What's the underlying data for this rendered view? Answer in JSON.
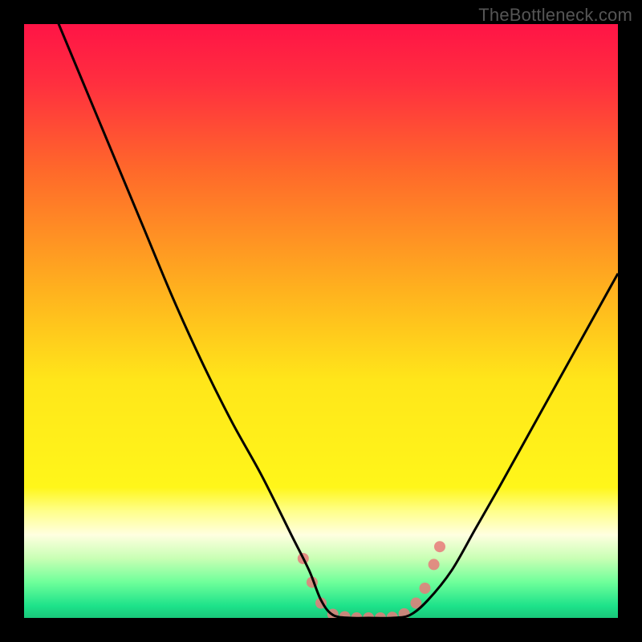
{
  "watermark": "TheBottleneck.com",
  "chart_data": {
    "type": "line",
    "title": "",
    "xlabel": "",
    "ylabel": "",
    "xlim": [
      0,
      100
    ],
    "ylim": [
      0,
      100
    ],
    "background_gradient": [
      {
        "stop": 0.0,
        "color": "#ff1446"
      },
      {
        "stop": 0.1,
        "color": "#ff2f3f"
      },
      {
        "stop": 0.25,
        "color": "#ff6a2a"
      },
      {
        "stop": 0.45,
        "color": "#ffb21e"
      },
      {
        "stop": 0.6,
        "color": "#ffe61a"
      },
      {
        "stop": 0.78,
        "color": "#fff61a"
      },
      {
        "stop": 0.82,
        "color": "#ffff8a"
      },
      {
        "stop": 0.86,
        "color": "#ffffe0"
      },
      {
        "stop": 0.9,
        "color": "#c8ffb4"
      },
      {
        "stop": 0.94,
        "color": "#6eff9a"
      },
      {
        "stop": 0.98,
        "color": "#1de28a"
      },
      {
        "stop": 1.0,
        "color": "#19c87a"
      }
    ],
    "series": [
      {
        "name": "bottleneck-curve",
        "color": "#000000",
        "x": [
          5,
          10,
          15,
          20,
          25,
          30,
          35,
          40,
          45,
          48,
          50,
          52,
          55,
          58,
          62,
          65,
          68,
          72,
          76,
          80,
          85,
          90,
          95,
          100
        ],
        "y": [
          102,
          90,
          78,
          66,
          54,
          43,
          33,
          24,
          14,
          8,
          3,
          0.5,
          0,
          0,
          0,
          0.5,
          3,
          8,
          15,
          22,
          31,
          40,
          49,
          58
        ]
      }
    ],
    "markers": {
      "name": "highlight-dots",
      "color": "#e77a7a",
      "radius": 7,
      "points": [
        {
          "x": 47,
          "y": 10
        },
        {
          "x": 48.5,
          "y": 6
        },
        {
          "x": 50,
          "y": 2.5
        },
        {
          "x": 52,
          "y": 0.6
        },
        {
          "x": 54,
          "y": 0.2
        },
        {
          "x": 56,
          "y": 0.0
        },
        {
          "x": 58,
          "y": 0.0
        },
        {
          "x": 60,
          "y": 0.0
        },
        {
          "x": 62,
          "y": 0.1
        },
        {
          "x": 64,
          "y": 0.7
        },
        {
          "x": 66,
          "y": 2.5
        },
        {
          "x": 67.5,
          "y": 5
        },
        {
          "x": 69,
          "y": 9
        },
        {
          "x": 70,
          "y": 12
        }
      ]
    }
  }
}
